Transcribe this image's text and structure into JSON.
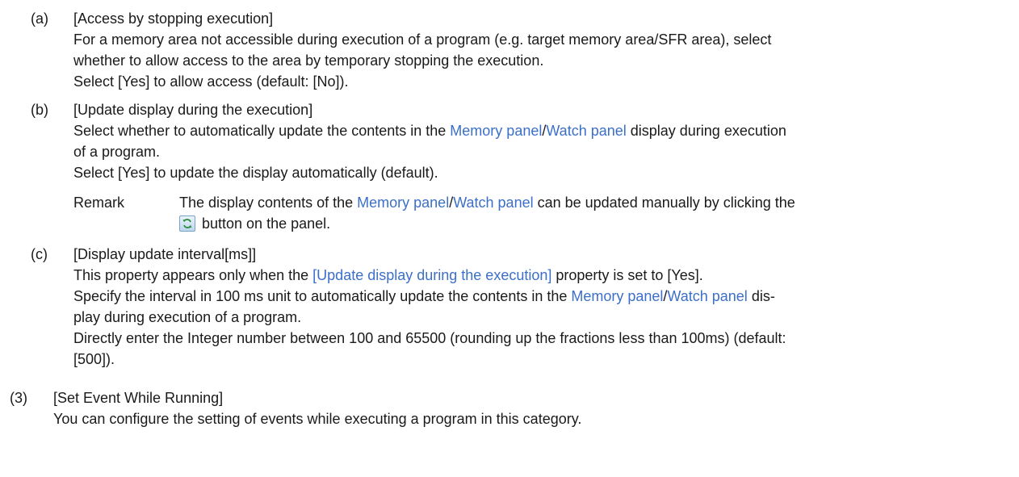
{
  "a": {
    "marker": "(a)",
    "title": "[Access by stopping execution]",
    "line1": "For a memory area not accessible during execution of a program (e.g. target memory area/SFR area), select",
    "line2": "whether to allow access to the area by temporary stopping the execution.",
    "line3": "Select [Yes] to allow access (default: [No])."
  },
  "b": {
    "marker": "(b)",
    "title": "[Update display during the execution]",
    "line1_pre": "Select whether to automatically update the contents in the ",
    "link_memory": "Memory panel",
    "slash": "/",
    "link_watch": "Watch panel",
    "line1_post": " display during execution",
    "line2": "of a program.",
    "line3": "Select [Yes] to update the display automatically (default).",
    "remark_label": "Remark",
    "remark_pre": "The display contents of the ",
    "remark_post": " can be updated manually by clicking the",
    "remark_line2": "button on the panel."
  },
  "c": {
    "marker": "(c)",
    "title": "[Display update interval[ms]]",
    "line1_pre": "This property appears only when the ",
    "line1_link": "[Update display during the execution]",
    "line1_post": " property is set to [Yes].",
    "line2_pre": "Specify the interval in 100 ms unit to automatically update the contents in the ",
    "line2_post": " dis-",
    "line3": "play during execution of a program.",
    "line4": "Directly enter the Integer number between 100 and 65500 (rounding up the fractions less than 100ms) (default:",
    "line5": "[500])."
  },
  "s3": {
    "marker": "(3)",
    "title": "[Set Event While Running]",
    "line1": "You can configure the setting of events while executing a program in this category."
  },
  "icons": {
    "refresh": "refresh-icon"
  },
  "colors": {
    "link": "#3b6fc9",
    "text": "#1a1a1a"
  }
}
